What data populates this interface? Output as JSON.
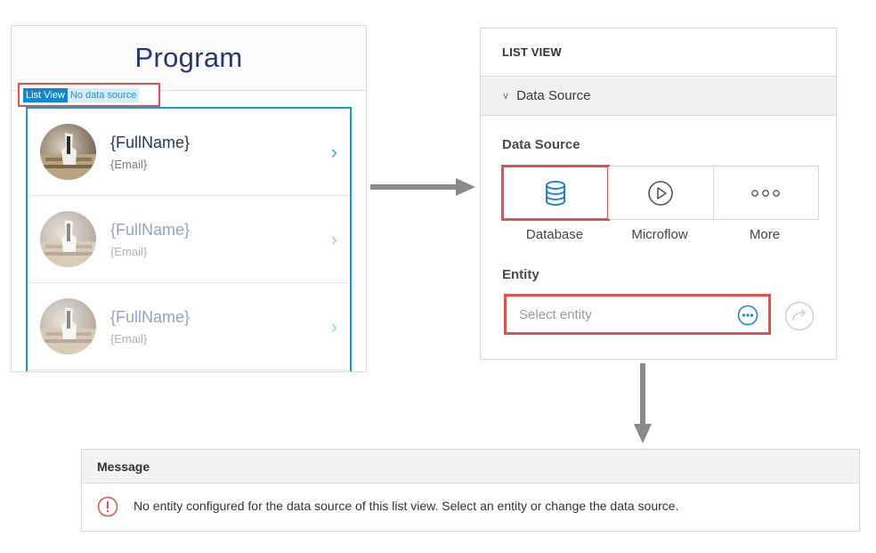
{
  "program": {
    "title": "Program",
    "tag_widget": "List View",
    "tag_source": "No data source",
    "rows": [
      {
        "name": "{FullName}",
        "email": "{Email}"
      },
      {
        "name": "{FullName}",
        "email": "{Email}"
      },
      {
        "name": "{FullName}",
        "email": "{Email}"
      }
    ]
  },
  "properties": {
    "header": "LIST VIEW",
    "section": "Data Source",
    "data_source_label": "Data Source",
    "options": [
      {
        "label": "Database",
        "icon": "database-icon",
        "selected": true
      },
      {
        "label": "Microflow",
        "icon": "play-circle-icon",
        "selected": false
      },
      {
        "label": "More",
        "icon": "ellipsis-icon",
        "selected": false
      }
    ],
    "entity_label": "Entity",
    "entity_placeholder": "Select entity"
  },
  "message": {
    "header": "Message",
    "text": "No entity configured for the data source of this list view. Select an entity or change the data source."
  },
  "colors": {
    "highlight": "#e0504f",
    "accent": "#0f86d1",
    "title": "#27396b"
  }
}
